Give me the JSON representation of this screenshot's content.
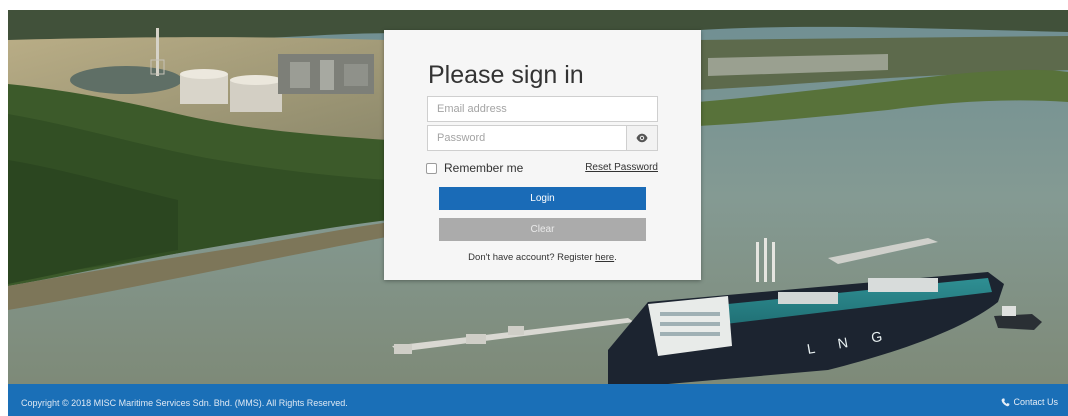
{
  "signin": {
    "title": "Please sign in",
    "email_placeholder": "Email address",
    "password_placeholder": "Password",
    "remember_label": "Remember me",
    "reset_label": "Reset Password",
    "login_label": "Login",
    "clear_label": "Clear",
    "register_prefix": "Don't have account? Register ",
    "register_link": "here",
    "register_suffix": "."
  },
  "footer": {
    "copyright": "Copyright © 2018 MISC Maritime Services Sdn. Bhd. (MMS). All Rights Reserved.",
    "contact_label": "Contact Us"
  },
  "ship": {
    "hull_text": "L N G"
  },
  "colors": {
    "primary": "#1a6bb7",
    "footer": "#1a6fb7",
    "clear": "#ababab"
  },
  "icons": {
    "password_toggle": "eye-icon",
    "contact": "phone-icon"
  }
}
